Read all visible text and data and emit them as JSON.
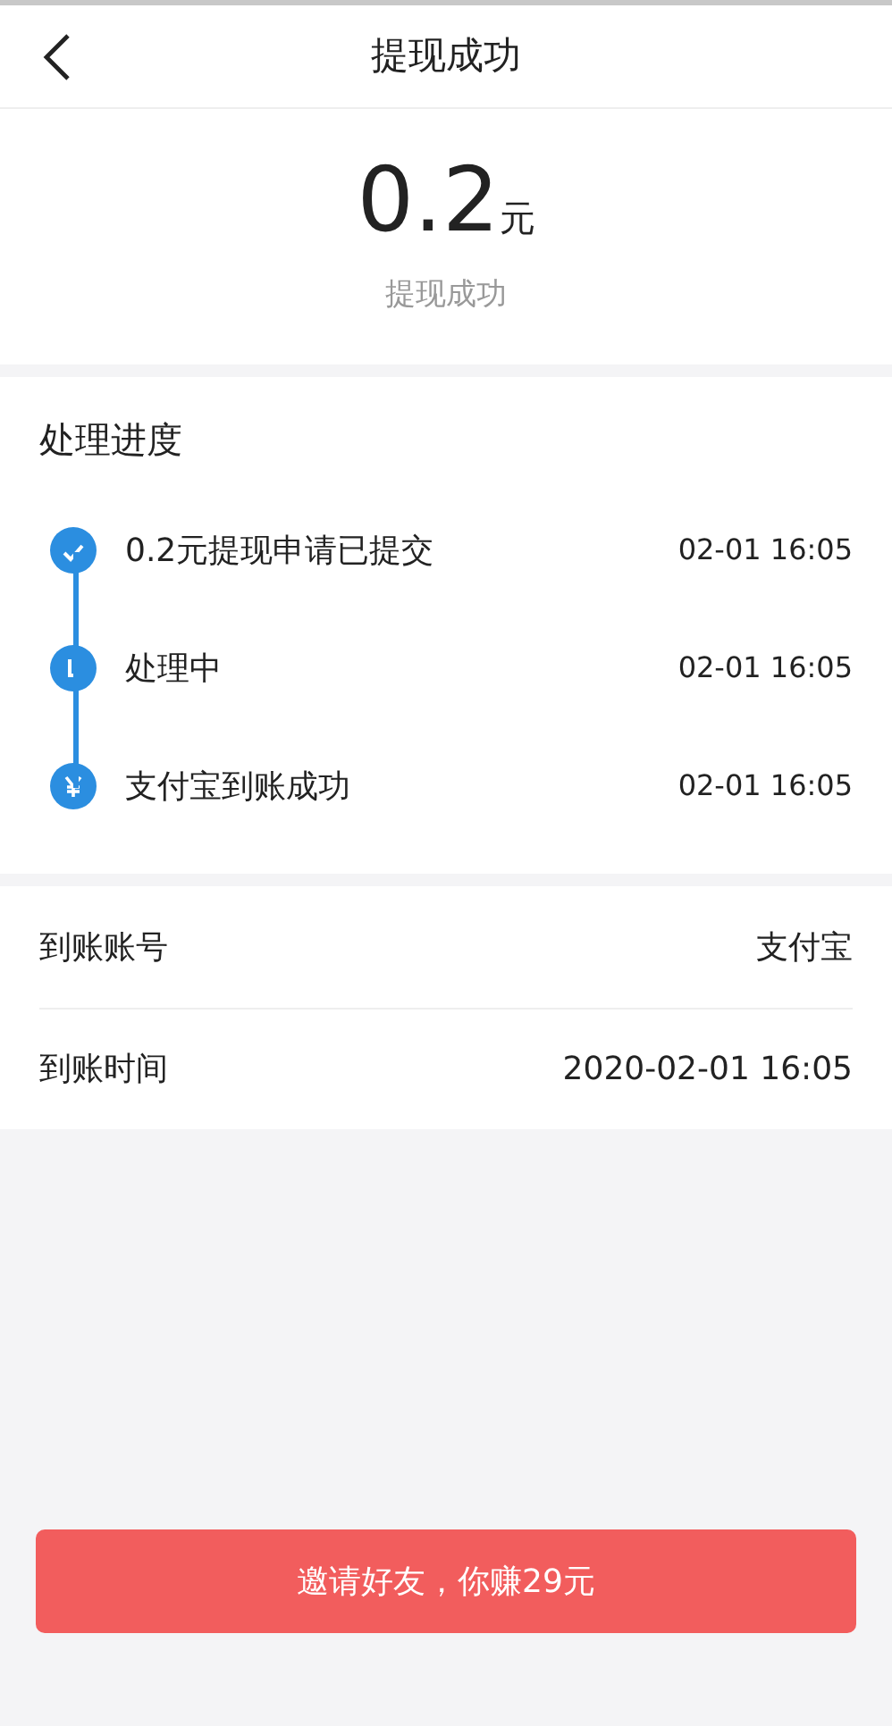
{
  "header": {
    "title": "提现成功"
  },
  "amount": {
    "value": "0.2",
    "unit": "元",
    "status": "提现成功"
  },
  "progress": {
    "title": "处理进度",
    "steps": [
      {
        "kind": "check",
        "text": "0.2元提现申请已提交",
        "time": "02-01 16:05"
      },
      {
        "kind": "clock",
        "text": "处理中",
        "time": "02-01 16:05"
      },
      {
        "kind": "yen",
        "text": "支付宝到账成功",
        "time": "02-01 16:05"
      }
    ]
  },
  "details": [
    {
      "label": "到账账号",
      "value": "支付宝"
    },
    {
      "label": "到账时间",
      "value": "2020-02-01 16:05"
    }
  ],
  "invite_button": "邀请好友，你赚29元"
}
